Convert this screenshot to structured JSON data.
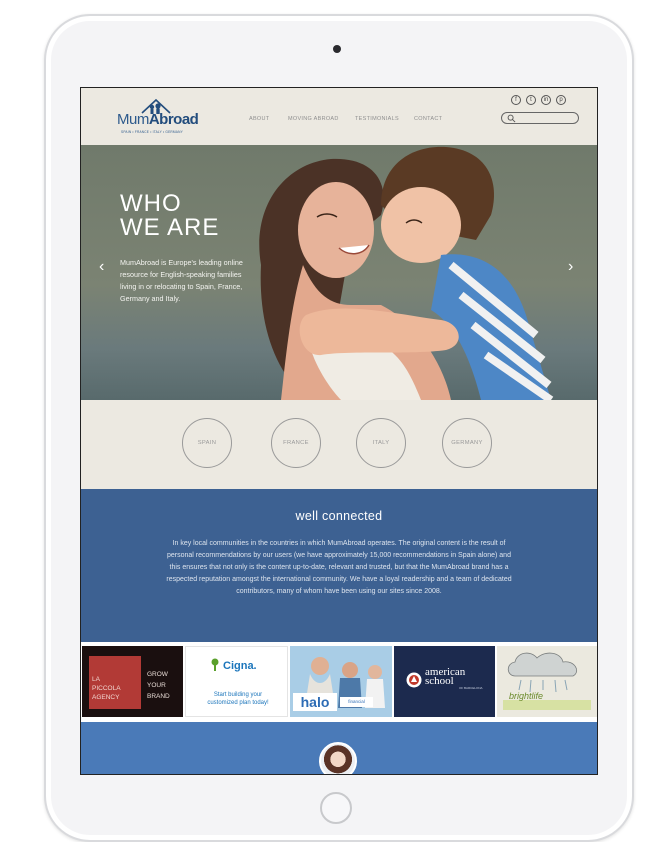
{
  "brand": {
    "name_part1": "Mum",
    "name_part2": "Abroad",
    "tagline": "SPAIN • FRANCE • ITALY • GERMANY"
  },
  "nav": {
    "items": [
      "ABOUT",
      "MOVING ABROAD",
      "TESTIMONIALS",
      "CONTACT"
    ]
  },
  "social": {
    "icons": [
      "facebook-icon",
      "twitter-icon",
      "linkedin-icon",
      "pinterest-icon"
    ],
    "glyphs": [
      "f",
      "t",
      "in",
      "p"
    ]
  },
  "search": {
    "placeholder": ""
  },
  "hero": {
    "title": "WHO\nWE ARE",
    "description": "MumAbroad is Europe's leading online resource for English-speaking families living in or relocating to Spain, France, Germany and Italy.",
    "prev_glyph": "‹",
    "next_glyph": "›"
  },
  "countries": [
    "SPAIN",
    "FRANCE",
    "ITALY",
    "GERMANY"
  ],
  "well_connected": {
    "title": "well connected",
    "body": "In key local communities in the countries in which MumAbroad operates. The original content is the result of personal recommendations by our users (we have approximately 15,000 recommendations in Spain alone) and this ensures that not only is the content up-to-date, relevant and trusted, but that the MumAbroad brand has a respected reputation amongst the international community. We have a loyal readership and a team of dedicated contributors, many of whom have been using our sites since 2008."
  },
  "ads": {
    "piccola": {
      "left_lines": [
        "LA",
        "PICCOLA",
        "AGENCY"
      ],
      "right_lines": [
        "GROW",
        "YOUR",
        "BRAND"
      ]
    },
    "cigna": {
      "brand": "Cigna.",
      "tagline": "Start building your customized plan today!"
    },
    "halo": {
      "brand": "halo",
      "sub": "financial"
    },
    "american_school": {
      "line1": "american",
      "line2": "school",
      "line3": "OF BARCELONA"
    },
    "kids": {
      "brand": "brightlife"
    }
  },
  "colors": {
    "brand_blue": "#3d6192",
    "nav_text": "#8f8f8f",
    "page_bg": "#ece9e1",
    "footer_blue": "#4a7ab8"
  }
}
